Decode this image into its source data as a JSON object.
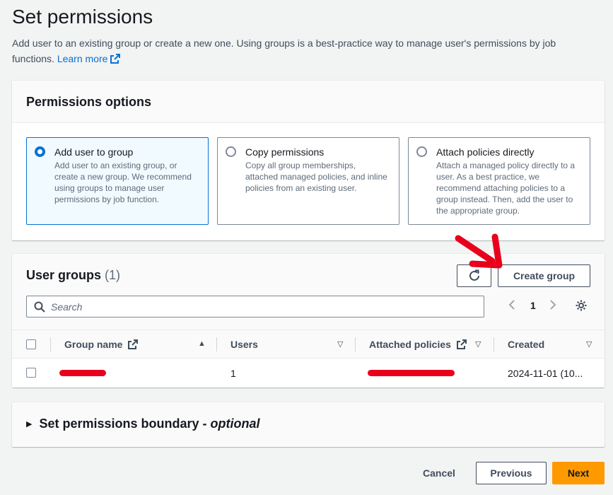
{
  "page": {
    "title": "Set permissions",
    "description": "Add user to an existing group or create a new one. Using groups is a best-practice way to manage user's permissions by job functions.",
    "learn_more": "Learn more"
  },
  "permissions": {
    "header": "Permissions options",
    "options": [
      {
        "title": "Add user to group",
        "desc": "Add user to an existing group, or create a new group. We recommend using groups to manage user permissions by job function.",
        "selected": true
      },
      {
        "title": "Copy permissions",
        "desc": "Copy all group memberships, attached managed policies, and inline policies from an existing user.",
        "selected": false
      },
      {
        "title": "Attach policies directly",
        "desc": "Attach a managed policy directly to a user. As a best practice, we recommend attaching policies to a group instead. Then, add the user to the appropriate group.",
        "selected": false
      }
    ]
  },
  "groups": {
    "title": "User groups",
    "count": "(1)",
    "create_label": "Create group",
    "search_placeholder": "Search",
    "page_number": "1",
    "columns": {
      "name": "Group name",
      "users": "Users",
      "policies": "Attached policies",
      "created": "Created"
    },
    "rows": [
      {
        "users": "1",
        "created": "2024-11-01 (10..."
      }
    ]
  },
  "boundary": {
    "title": "Set permissions boundary - ",
    "optional": "optional"
  },
  "footer": {
    "cancel": "Cancel",
    "previous": "Previous",
    "next": "Next"
  },
  "colors": {
    "accent": "#0972d3",
    "primary_button": "#ff9900",
    "redaction": "#e8001c"
  },
  "icons": [
    "external-link-icon",
    "refresh-icon",
    "search-icon",
    "chevron-left-icon",
    "chevron-right-icon",
    "gear-icon",
    "sort-up-icon",
    "sort-down-icon",
    "caret-right-icon",
    "red-arrow-annotation"
  ]
}
